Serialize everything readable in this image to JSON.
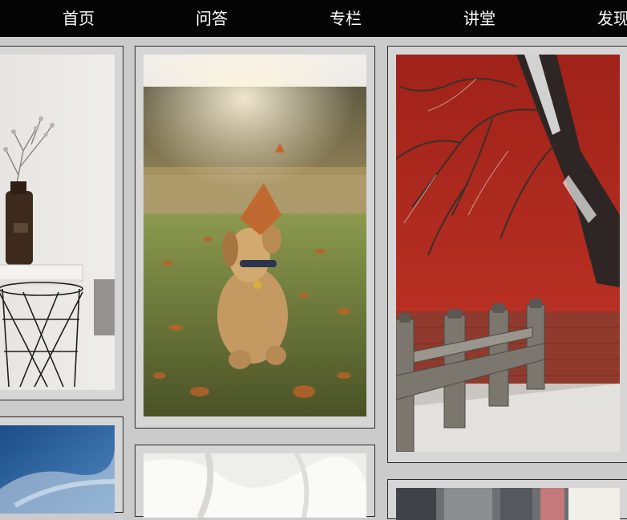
{
  "nav": {
    "items": [
      {
        "label": "首页"
      },
      {
        "label": "问答"
      },
      {
        "label": "专栏"
      },
      {
        "label": "讲堂"
      },
      {
        "label": "发现"
      }
    ]
  },
  "colors": {
    "nav_background": "#050505",
    "nav_text": "#ffffff",
    "page_background": "#cbcbcb",
    "card_background": "#d6d6d6",
    "card_border": "#2a2a2a"
  },
  "photos": [
    {
      "subject": "vase-with-dried-branches-on-wire-stool"
    },
    {
      "subject": "puppy-sniffing-falling-autumn-leaf"
    },
    {
      "subject": "snowy-tree-by-red-palace-wall-and-stone-balustrade"
    },
    {
      "subject": "blue-sky-with-clouds"
    },
    {
      "subject": "white-fabric"
    },
    {
      "subject": "city-street-buildings"
    }
  ]
}
